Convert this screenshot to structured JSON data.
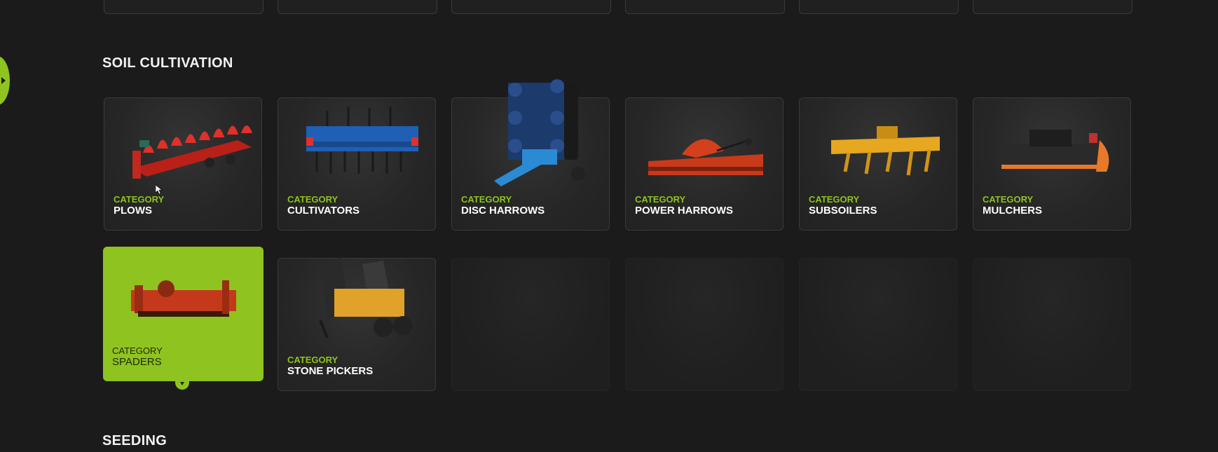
{
  "sections": {
    "soil_title": "SOIL CULTIVATION",
    "seeding_title": "SEEDING"
  },
  "cards": [
    {
      "category": "CATEGORY",
      "name": "PLOWS",
      "color": "#d42a22"
    },
    {
      "category": "CATEGORY",
      "name": "CULTIVATORS",
      "color": "#1f5fb4"
    },
    {
      "category": "CATEGORY",
      "name": "DISC HARROWS",
      "color": "#2a6cc4"
    },
    {
      "category": "CATEGORY",
      "name": "POWER HARROWS",
      "color": "#d4401c"
    },
    {
      "category": "CATEGORY",
      "name": "SUBSOILERS",
      "color": "#e6a820"
    },
    {
      "category": "CATEGORY",
      "name": "MULCHERS",
      "color": "#2e2e2e"
    },
    {
      "category": "CATEGORY",
      "name": "SPADERS",
      "color": "#c4391c",
      "selected": true
    },
    {
      "category": "CATEGORY",
      "name": "STONE PICKERS",
      "color": "#e0a22a"
    }
  ],
  "accent_color": "#8fc31f"
}
